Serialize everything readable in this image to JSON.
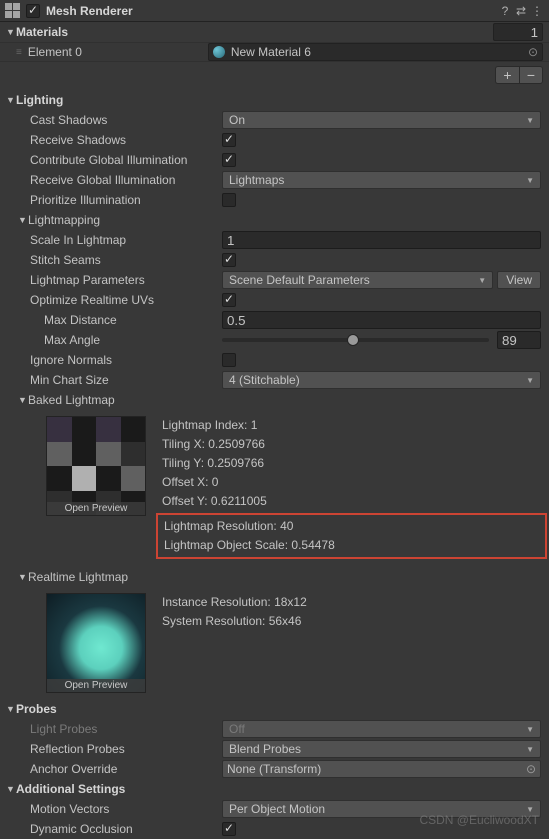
{
  "header": {
    "title": "Mesh Renderer",
    "enabled": true,
    "icons": {
      "help": "?",
      "preset": "⇄",
      "menu": "⋮"
    }
  },
  "materials": {
    "title": "Materials",
    "size": "1",
    "element_label": "Element 0",
    "element_value": "New Material 6",
    "open_preview": "Open Preview",
    "plus": "+",
    "minus": "−"
  },
  "lighting": {
    "title": "Lighting",
    "cast_shadows": {
      "label": "Cast Shadows",
      "value": "On"
    },
    "receive_shadows": {
      "label": "Receive Shadows",
      "checked": true
    },
    "contribute_gi": {
      "label": "Contribute Global Illumination",
      "checked": true
    },
    "receive_gi": {
      "label": "Receive Global Illumination",
      "value": "Lightmaps"
    },
    "prioritize": {
      "label": "Prioritize Illumination",
      "checked": false
    }
  },
  "lightmapping": {
    "title": "Lightmapping",
    "scale": {
      "label": "Scale In Lightmap",
      "value": "1"
    },
    "stitch": {
      "label": "Stitch Seams",
      "checked": true
    },
    "params": {
      "label": "Lightmap Parameters",
      "value": "Scene Default Parameters",
      "btn": "View"
    },
    "optimize": {
      "label": "Optimize Realtime UVs",
      "checked": true
    },
    "max_dist": {
      "label": "Max Distance",
      "value": "0.5"
    },
    "max_angle": {
      "label": "Max Angle",
      "value": "89",
      "pct": 49
    },
    "ignore_normals": {
      "label": "Ignore Normals",
      "checked": false
    },
    "min_chart": {
      "label": "Min Chart Size",
      "value": "4 (Stitchable)"
    }
  },
  "baked": {
    "title": "Baked Lightmap",
    "index": "Lightmap Index: 1",
    "tx": "Tiling X: 0.2509766",
    "ty": "Tiling Y: 0.2509766",
    "ox": "Offset X: 0",
    "oy": "Offset Y: 0.6211005",
    "res": "Lightmap Resolution: 40",
    "scale": "Lightmap Object Scale: 0.54478"
  },
  "realtime": {
    "title": "Realtime Lightmap",
    "inst": "Instance Resolution: 18x12",
    "sys": "System Resolution: 56x46"
  },
  "probes": {
    "title": "Probes",
    "light": {
      "label": "Light Probes",
      "value": "Off"
    },
    "reflection": {
      "label": "Reflection Probes",
      "value": "Blend Probes"
    },
    "anchor": {
      "label": "Anchor Override",
      "value": "None (Transform)"
    }
  },
  "additional": {
    "title": "Additional Settings",
    "motion": {
      "label": "Motion Vectors",
      "value": "Per Object Motion"
    },
    "dyn": {
      "label": "Dynamic Occlusion",
      "checked": true
    }
  },
  "watermark": "CSDN @EucliwoodXT"
}
